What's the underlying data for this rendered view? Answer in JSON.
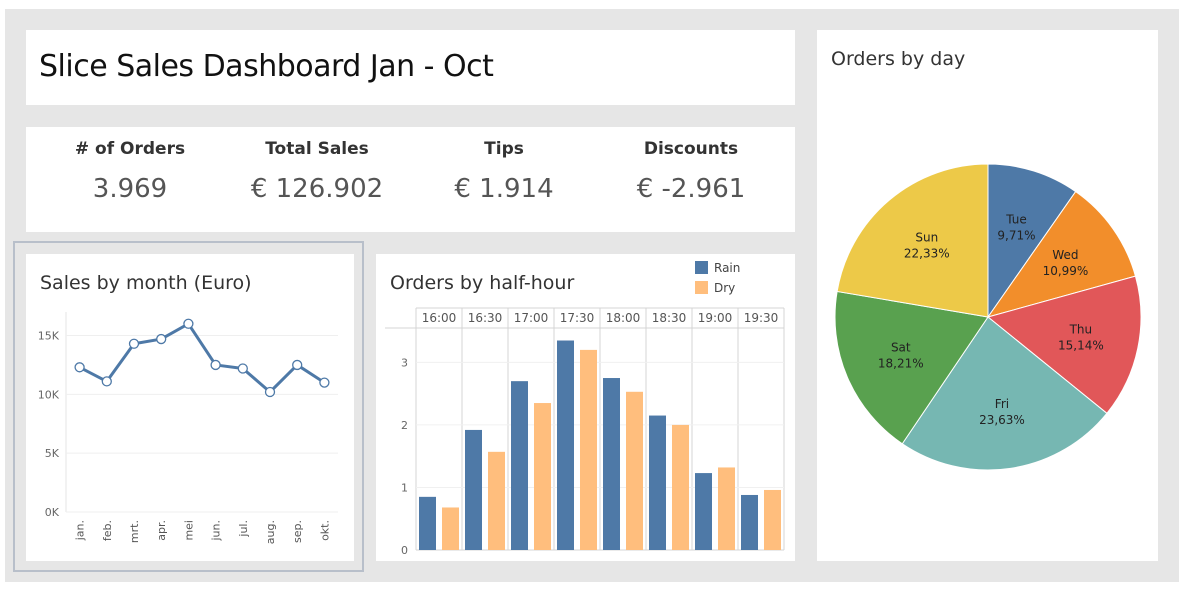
{
  "dashboard": {
    "title": "Slice Sales Dashboard Jan - Oct"
  },
  "kpis": [
    {
      "label": "# of Orders",
      "value": "3.969"
    },
    {
      "label": "Total Sales",
      "value": "€ 126.902"
    },
    {
      "label": "Tips",
      "value": "€ 1.914"
    },
    {
      "label": "Discounts",
      "value": "€ -2.961"
    }
  ],
  "colors": {
    "rain": "#4e79a7",
    "dry": "#ffbe7d",
    "line": "#4e79a7",
    "sun": "#edc948",
    "tue": "#4e79a7",
    "wed": "#f28e2b",
    "thu": "#e15759",
    "fri": "#76b7b2",
    "sat": "#59a14f"
  },
  "chart_data": [
    {
      "type": "line",
      "title": "Sales by month (Euro)",
      "categories": [
        "jan.",
        "feb.",
        "mrt.",
        "apr.",
        "mei",
        "jun.",
        "jul.",
        "aug.",
        "sep.",
        "okt."
      ],
      "values": [
        12300,
        11100,
        14300,
        14700,
        16000,
        12500,
        12200,
        10200,
        12500,
        11000
      ],
      "ytick_labels": [
        "0K",
        "5K",
        "10K",
        "15K"
      ],
      "ylim": [
        0,
        17000
      ],
      "grid": true
    },
    {
      "type": "bar",
      "title": "Orders by half-hour",
      "categories": [
        "16:00",
        "16:30",
        "17:00",
        "17:30",
        "18:00",
        "18:30",
        "19:00",
        "19:30"
      ],
      "series": [
        {
          "name": "Rain",
          "values": [
            0.85,
            1.92,
            2.7,
            3.35,
            2.75,
            2.15,
            1.23,
            0.88
          ]
        },
        {
          "name": "Dry",
          "values": [
            0.68,
            1.57,
            2.35,
            3.2,
            2.53,
            2.0,
            1.32,
            0.96
          ]
        }
      ],
      "yticks": [
        0,
        1,
        2,
        3
      ],
      "ylim": [
        0,
        3.55
      ],
      "legend": "top-right"
    },
    {
      "type": "pie",
      "title": "Orders by day",
      "slices": [
        {
          "label": "Tue",
          "value": 9.71,
          "text": "9,71%",
          "color_key": "tue"
        },
        {
          "label": "Wed",
          "value": 10.99,
          "text": "10,99%",
          "color_key": "wed"
        },
        {
          "label": "Thu",
          "value": 15.14,
          "text": "15,14%",
          "color_key": "thu"
        },
        {
          "label": "Fri",
          "value": 23.63,
          "text": "23,63%",
          "color_key": "fri"
        },
        {
          "label": "Sat",
          "value": 18.21,
          "text": "18,21%",
          "color_key": "sat"
        },
        {
          "label": "Sun",
          "value": 22.33,
          "text": "22,33%",
          "color_key": "sun"
        }
      ]
    }
  ]
}
